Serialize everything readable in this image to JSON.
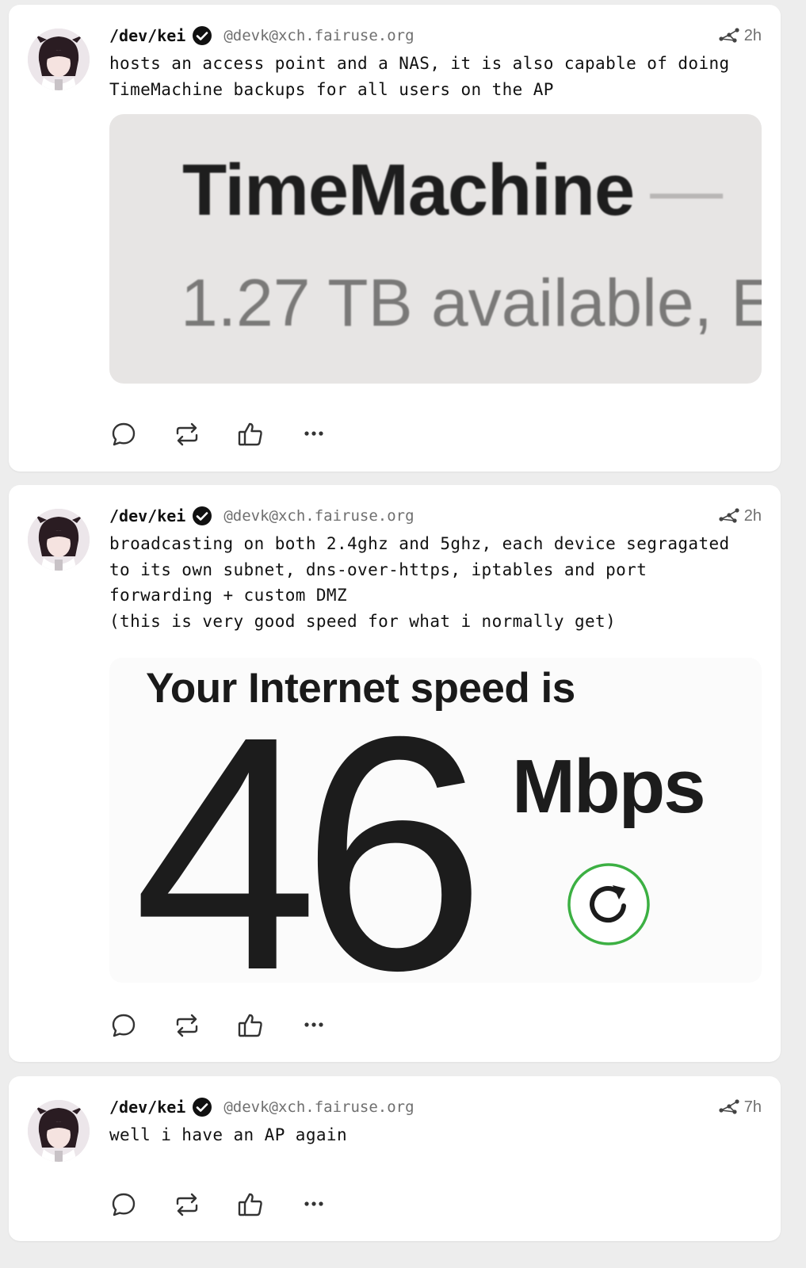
{
  "posts": [
    {
      "author": "/dev/kei",
      "handle": "@devk@xch.fairuse.org",
      "time": "2h",
      "text": "hosts an access point and a NAS, it is also capable of doing\nTimeMachine backups for all users on the AP",
      "image": {
        "title": "TimeMachine",
        "dash": "—",
        "subtitle": "1.27 TB available, E"
      }
    },
    {
      "author": "/dev/kei",
      "handle": "@devk@xch.fairuse.org",
      "time": "2h",
      "text": "broadcasting on both 2.4ghz and 5ghz, each device segragated\nto its own subnet, dns-over-https, iptables and port\nforwarding + custom DMZ\n(this is very good speed for what i normally get)",
      "image": {
        "heading": "Your Internet speed is",
        "value": "46",
        "unit": "Mbps"
      }
    },
    {
      "author": "/dev/kei",
      "handle": "@devk@xch.fairuse.org",
      "time": "7h",
      "text": "well i have an AP again"
    }
  ],
  "icons": {
    "reply": "reply-icon",
    "boost": "boost-icon",
    "like": "like-icon",
    "more": "more-icon",
    "verified": "verified-badge-icon",
    "federated": "federated-icon",
    "refresh": "refresh-icon"
  },
  "colors": {
    "refresh_ring": "#3cb043",
    "handle_gray": "#6f6f6f"
  }
}
